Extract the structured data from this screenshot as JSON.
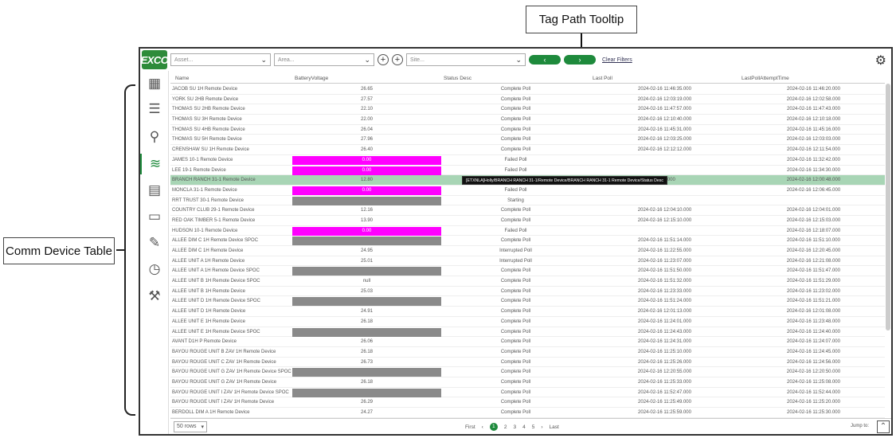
{
  "annotations": {
    "tooltip_label": "Tag Path Tooltip",
    "table_label": "Comm Device Table"
  },
  "toolbar": {
    "logo": "EXCO",
    "asset_placeholder": "Asset...",
    "area_placeholder": "Area...",
    "site_placeholder": "Site...",
    "clear_filters": "Clear Filters",
    "prev_label": "‹",
    "next_label": "›"
  },
  "sidebar": {
    "items": [
      {
        "icon": "dashboard-icon",
        "glyph": "▦"
      },
      {
        "icon": "list-icon",
        "glyph": "☰"
      },
      {
        "icon": "search-icon",
        "glyph": "⚲"
      },
      {
        "icon": "wireless-icon",
        "glyph": "≋"
      },
      {
        "icon": "document-icon",
        "glyph": "▤"
      },
      {
        "icon": "ticket-icon",
        "glyph": "▭"
      },
      {
        "icon": "pencil-icon",
        "glyph": "✎"
      },
      {
        "icon": "alarm-clock-icon",
        "glyph": "◷"
      },
      {
        "icon": "tools-icon",
        "glyph": "⚒"
      }
    ]
  },
  "table": {
    "columns": [
      "Name",
      "BatteryVoltage",
      "Status Desc",
      "Last Poll",
      "LastPollAttemptTime"
    ],
    "rows": [
      {
        "name": "JACOB SU 1H Remote Device",
        "volt": "26.65",
        "status": "Complete Poll",
        "last": "2024-02-16 11:46:35.000",
        "attempt": "2024-02-16 11:46:20.000",
        "box": ""
      },
      {
        "name": "YORK SU 2HB Remote Device",
        "volt": "27.57",
        "status": "Complete Poll",
        "last": "2024-02-16 12:03:19.000",
        "attempt": "2024-02-16 12:02:58.000",
        "box": ""
      },
      {
        "name": "THOMAS SU 2HB Remote Device",
        "volt": "22.10",
        "status": "Complete Poll",
        "last": "2024-02-16 11:47:57.000",
        "attempt": "2024-02-16 11:47:43.000",
        "box": ""
      },
      {
        "name": "THOMAS SU 3H Remote Device",
        "volt": "22.00",
        "status": "Complete Poll",
        "last": "2024-02-16 12:10:40.000",
        "attempt": "2024-02-16 12:10:18.000",
        "box": ""
      },
      {
        "name": "THOMAS SU 4HB Remote Device",
        "volt": "26.04",
        "status": "Complete Poll",
        "last": "2024-02-16 11:45:31.000",
        "attempt": "2024-02-16 11:45:16.000",
        "box": ""
      },
      {
        "name": "THOMAS SU 5H Remote Device",
        "volt": "27.96",
        "status": "Complete Poll",
        "last": "2024-02-16 12:03:25.000",
        "attempt": "2024-02-16 12:03:03.000",
        "box": ""
      },
      {
        "name": "CRENSHAW SU 1H Remote Device",
        "volt": "26.40",
        "status": "Complete Poll",
        "last": "2024-02-16 12:12:12.000",
        "attempt": "2024-02-16 12:11:54.000",
        "box": ""
      },
      {
        "name": "JAMES 10-1 Remote Device",
        "volt": "0.00",
        "status": "Failed Poll",
        "last": "",
        "attempt": "2024-02-16 11:32:42.000",
        "box": "magenta"
      },
      {
        "name": "LEE 19-1 Remote Device",
        "volt": "0.00",
        "status": "Failed Poll",
        "last": "",
        "attempt": "2024-02-16 11:34:30.000",
        "box": "magenta"
      },
      {
        "name": "BRANCH RANCH 31-1 Remote Device",
        "volt": "12.80",
        "status": "",
        "last": "01:46.000",
        "attempt": "2024-02-16 12:00:48.000",
        "box": "",
        "selected": true
      },
      {
        "name": "MONCLA 31-1 Remote Device",
        "volt": "0.00",
        "status": "Failed Poll",
        "last": "",
        "attempt": "2024-02-16 12:06:45.000",
        "box": "magenta"
      },
      {
        "name": "RRT TRUST 30-1 Remote Device",
        "volt": "",
        "status": "Starting",
        "last": "",
        "attempt": "",
        "box": "gray"
      },
      {
        "name": "COUNTRY CLUB 29-1 Remote Device",
        "volt": "12.16",
        "status": "Complete Poll",
        "last": "2024-02-16 12:04:10.000",
        "attempt": "2024-02-16 12:04:01.000",
        "box": ""
      },
      {
        "name": "RED OAK TIMBER 5-1 Remote Device",
        "volt": "13.90",
        "status": "Complete Poll",
        "last": "2024-02-16 12:15:10.000",
        "attempt": "2024-02-16 12:15:03.000",
        "box": ""
      },
      {
        "name": "HUDSON 10-1 Remote Device",
        "volt": "0.00",
        "status": "Failed Poll",
        "last": "",
        "attempt": "2024-02-16 12:18:07.000",
        "box": "magenta"
      },
      {
        "name": "ALLEE DIM C 1H Remote Device SPOC",
        "volt": "",
        "status": "Complete Poll",
        "last": "2024-02-16 11:51:14.000",
        "attempt": "2024-02-16 11:51:10.000",
        "box": "gray"
      },
      {
        "name": "ALLEE DIM C 1H Remote Device",
        "volt": "24.95",
        "status": "Interrupted Poll",
        "last": "2024-02-16 11:22:55.000",
        "attempt": "2024-02-16 12:20:45.000",
        "box": ""
      },
      {
        "name": "ALLEE UNIT A 1H Remote Device",
        "volt": "25.01",
        "status": "Interrupted Poll",
        "last": "2024-02-16 11:23:07.000",
        "attempt": "2024-02-16 12:21:08.000",
        "box": ""
      },
      {
        "name": "ALLEE UNIT A 1H Remote Device SPOC",
        "volt": "",
        "status": "Complete Poll",
        "last": "2024-02-16 11:51:50.000",
        "attempt": "2024-02-16 11:51:47.000",
        "box": "gray"
      },
      {
        "name": "ALLEE UNIT B 1H Remote Device SPOC",
        "volt": "null",
        "status": "Complete Poll",
        "last": "2024-02-16 11:51:32.000",
        "attempt": "2024-02-16 11:51:29.000",
        "box": ""
      },
      {
        "name": "ALLEE UNIT B 1H Remote Device",
        "volt": "25.03",
        "status": "Complete Poll",
        "last": "2024-02-16 11:23:33.000",
        "attempt": "2024-02-16 11:23:02.000",
        "box": ""
      },
      {
        "name": "ALLEE UNIT D 1H Remote Device SPOC",
        "volt": "",
        "status": "Complete Poll",
        "last": "2024-02-16 11:51:24.000",
        "attempt": "2024-02-16 11:51:21.000",
        "box": "gray"
      },
      {
        "name": "ALLEE UNIT D 1H Remote Device",
        "volt": "24.91",
        "status": "Complete Poll",
        "last": "2024-02-16 12:01:13.000",
        "attempt": "2024-02-16 12:01:08.000",
        "box": ""
      },
      {
        "name": "ALLEE UNIT E 1H Remote Device",
        "volt": "26.18",
        "status": "Complete Poll",
        "last": "2024-02-16 11:24:01.000",
        "attempt": "2024-02-16 11:23:48.000",
        "box": ""
      },
      {
        "name": "ALLEE UNIT E 1H Remote Device SPOC",
        "volt": "",
        "status": "Complete Poll",
        "last": "2024-02-16 11:24:43.000",
        "attempt": "2024-02-16 11:24:40.000",
        "box": "gray"
      },
      {
        "name": "AVANT D1H P Remote Device",
        "volt": "26.06",
        "status": "Complete Poll",
        "last": "2024-02-16 11:24:31.000",
        "attempt": "2024-02-16 11:24:07.000",
        "box": ""
      },
      {
        "name": "BAYOU ROUGE UNIT B ZAV 1H Remote Device",
        "volt": "26.18",
        "status": "Complete Poll",
        "last": "2024-02-16 11:25:10.000",
        "attempt": "2024-02-16 11:24:45.000",
        "box": ""
      },
      {
        "name": "BAYOU ROUGE UNIT C ZAV 1H Remote Device",
        "volt": "26.73",
        "status": "Complete Poll",
        "last": "2024-02-16 11:25:26.000",
        "attempt": "2024-02-16 11:24:56.000",
        "box": ""
      },
      {
        "name": "BAYOU ROUGE UNIT G ZAV 1H Remote Device SPOC",
        "volt": "",
        "status": "Complete Poll",
        "last": "2024-02-16 12:20:55.000",
        "attempt": "2024-02-16 12:20:50.000",
        "box": "gray"
      },
      {
        "name": "BAYOU ROUGE UNIT G ZAV 1H Remote Device",
        "volt": "26.18",
        "status": "Complete Poll",
        "last": "2024-02-16 11:25:33.000",
        "attempt": "2024-02-16 11:25:08.000",
        "box": ""
      },
      {
        "name": "BAYOU ROUGE UNIT I ZAV 1H Remote Device SPOC",
        "volt": "",
        "status": "Complete Poll",
        "last": "2024-02-16 11:52:47.000",
        "attempt": "2024-02-16 11:52:44.000",
        "box": "gray"
      },
      {
        "name": "BAYOU ROUGE UNIT I ZAV 1H Remote Device",
        "volt": "26.29",
        "status": "Complete Poll",
        "last": "2024-02-16 11:25:49.000",
        "attempt": "2024-02-16 11:25:20.000",
        "box": ""
      },
      {
        "name": "BERDOLL DIM A 1H Remote Device",
        "volt": "24.27",
        "status": "Complete Poll",
        "last": "2024-02-16 11:25:59.000",
        "attempt": "2024-02-16 11:25:30.000",
        "box": ""
      }
    ]
  },
  "tooltip": {
    "text": "[ETXNLA]Holly/BRANCH RANCH 31-1/Remote Device/BRANCH RANCH 31-1 Remote Device/Status Desc"
  },
  "footer": {
    "rows_label": "50 rows",
    "first": "First",
    "pages": [
      "1",
      "2",
      "3",
      "4",
      "5"
    ],
    "current_page": "1",
    "next": "›",
    "prev": "‹",
    "last": "Last",
    "jump": "Jump to:"
  },
  "colors": {
    "brand_green": "#1e8a3c",
    "selected_row": "#a8d5b5",
    "failed_magenta": "#ff00ff",
    "no_data_gray": "#8a8a8a"
  }
}
